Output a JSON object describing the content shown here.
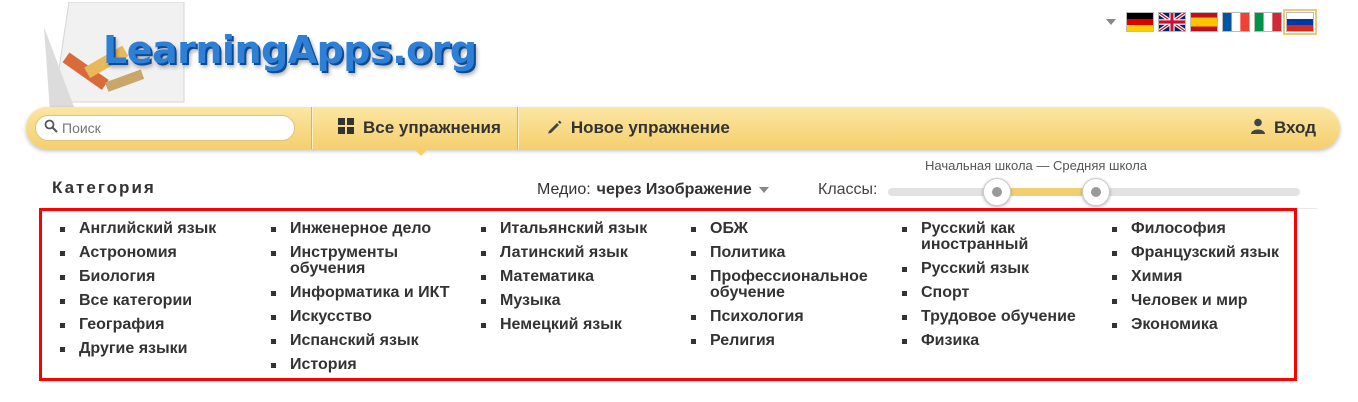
{
  "logo": {
    "text": "LearningApps.org"
  },
  "languages": [
    {
      "code": "de",
      "icon": "flag-de-icon"
    },
    {
      "code": "en",
      "icon": "flag-gb-icon"
    },
    {
      "code": "es",
      "icon": "flag-es-icon"
    },
    {
      "code": "fr",
      "icon": "flag-fr-icon"
    },
    {
      "code": "it",
      "icon": "flag-it-icon"
    },
    {
      "code": "ru",
      "icon": "flag-ru-icon",
      "active": true
    }
  ],
  "nav": {
    "search_placeholder": "Поиск",
    "all_exercises": "Все упражнения",
    "new_exercise": "Новое упражнение",
    "login": "Вход"
  },
  "filter": {
    "category_title": "Категория",
    "medium_label": "Медио:",
    "medium_value": "через Изображение",
    "classes_label": "Классы:",
    "grade_range": "Начальная школа — Средняя школа"
  },
  "colors": {
    "accent": "#f5cf6e",
    "highlight_border": "#ff0000",
    "logo_blue": "#2e7fd6"
  },
  "categories": [
    [
      "Английский язык",
      "Астрономия",
      "Биология",
      "Все категории",
      "География",
      "Другие языки"
    ],
    [
      "Инженерное дело",
      "Инструменты обучения",
      "Информатика и ИКТ",
      "Искусство",
      "Испанский язык",
      "История"
    ],
    [
      "Итальянский язык",
      "Латинский язык",
      "Математика",
      "Музыка",
      "Немецкий язык"
    ],
    [
      "ОБЖ",
      "Политика",
      "Профессиональное обучение",
      "Психология",
      "Религия"
    ],
    [
      "Русский как иностранный",
      "Русский язык",
      "Спорт",
      "Трудовое обучение",
      "Физика"
    ],
    [
      "Философия",
      "Французский язык",
      "Химия",
      "Человек и мир",
      "Экономика"
    ]
  ]
}
